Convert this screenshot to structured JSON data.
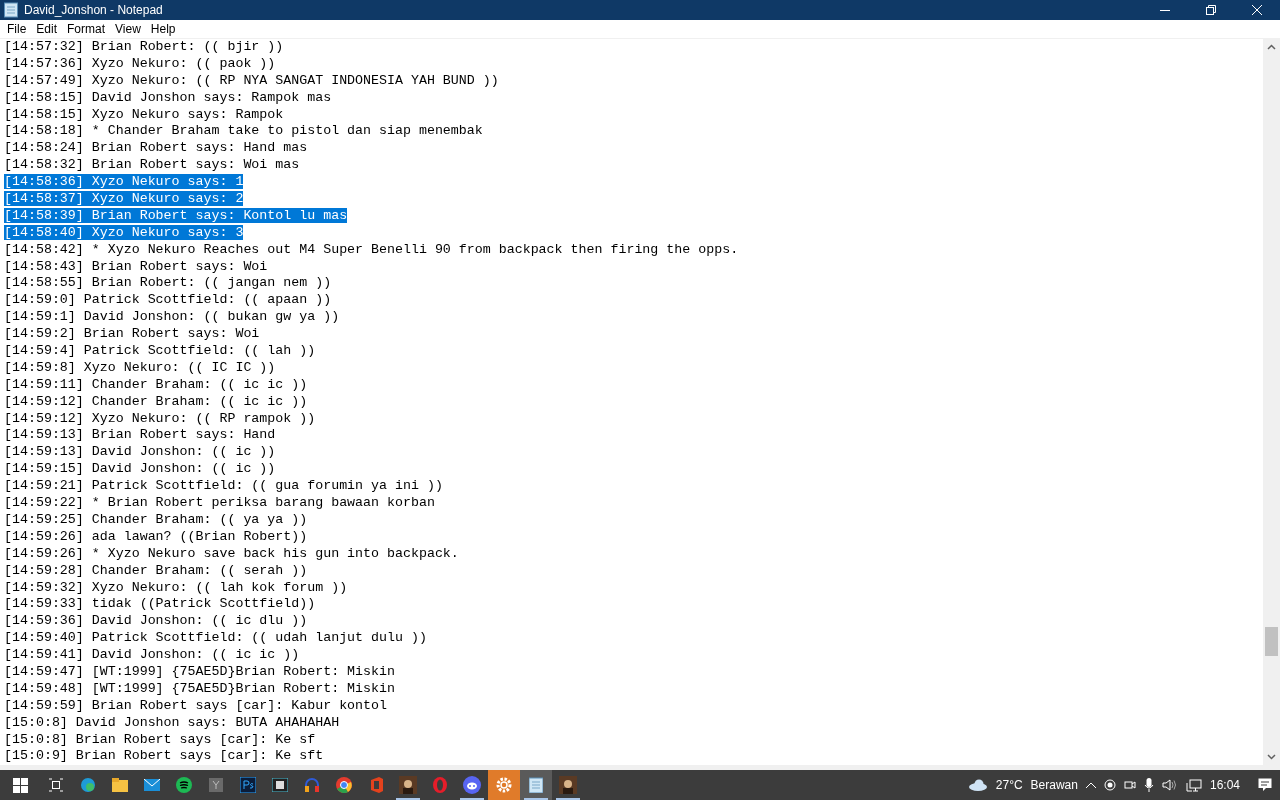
{
  "window": {
    "title": "David_Jonshon - Notepad"
  },
  "menu": [
    "File",
    "Edit",
    "Format",
    "View",
    "Help"
  ],
  "lines": [
    {
      "text": "[14:57:32] Brian Robert: (( bjir ))",
      "selected": false
    },
    {
      "text": "[14:57:36] Xyzo Nekuro: (( paok ))",
      "selected": false
    },
    {
      "text": "[14:57:49] Xyzo Nekuro: (( RP NYA SANGAT INDONESIA YAH BUND ))",
      "selected": false
    },
    {
      "text": "[14:58:15] David Jonshon says: Rampok mas",
      "selected": false
    },
    {
      "text": "[14:58:15] Xyzo Nekuro says: Rampok",
      "selected": false
    },
    {
      "text": "[14:58:18] * Chander Braham take to pistol dan siap menembak",
      "selected": false
    },
    {
      "text": "[14:58:24] Brian Robert says: Hand mas",
      "selected": false
    },
    {
      "text": "[14:58:32] Brian Robert says: Woi mas",
      "selected": false
    },
    {
      "text": "[14:58:36] Xyzo Nekuro says: 1",
      "selected": true
    },
    {
      "text": "[14:58:37] Xyzo Nekuro says: 2",
      "selected": true
    },
    {
      "text": "[14:58:39] Brian Robert says: Kontol lu mas",
      "selected": true
    },
    {
      "text": "[14:58:40] Xyzo Nekuro says: 3",
      "selected": true
    },
    {
      "text": "[14:58:42] * Xyzo Nekuro Reaches out M4 Super Benelli 90 from backpack then firing the opps.",
      "selected": false
    },
    {
      "text": "[14:58:43] Brian Robert says: Woi",
      "selected": false
    },
    {
      "text": "[14:58:55] Brian Robert: (( jangan nem ))",
      "selected": false
    },
    {
      "text": "[14:59:0] Patrick Scottfield: (( apaan ))",
      "selected": false
    },
    {
      "text": "[14:59:1] David Jonshon: (( bukan gw ya ))",
      "selected": false
    },
    {
      "text": "[14:59:2] Brian Robert says: Woi",
      "selected": false
    },
    {
      "text": "[14:59:4] Patrick Scottfield: (( lah ))",
      "selected": false
    },
    {
      "text": "[14:59:8] Xyzo Nekuro: (( IC IC ))",
      "selected": false
    },
    {
      "text": "[14:59:11] Chander Braham: (( ic ic ))",
      "selected": false
    },
    {
      "text": "[14:59:12] Chander Braham: (( ic ic ))",
      "selected": false
    },
    {
      "text": "[14:59:12] Xyzo Nekuro: (( RP rampok ))",
      "selected": false
    },
    {
      "text": "[14:59:13] Brian Robert says: Hand",
      "selected": false
    },
    {
      "text": "[14:59:13] David Jonshon: (( ic ))",
      "selected": false
    },
    {
      "text": "[14:59:15] David Jonshon: (( ic ))",
      "selected": false
    },
    {
      "text": "[14:59:21] Patrick Scottfield: (( gua forumin ya ini ))",
      "selected": false
    },
    {
      "text": "[14:59:22] * Brian Robert periksa barang bawaan korban",
      "selected": false
    },
    {
      "text": "[14:59:25] Chander Braham: (( ya ya ))",
      "selected": false
    },
    {
      "text": "[14:59:26] ada lawan? ((Brian Robert))",
      "selected": false
    },
    {
      "text": "[14:59:26] * Xyzo Nekuro save back his gun into backpack.",
      "selected": false
    },
    {
      "text": "[14:59:28] Chander Braham: (( serah ))",
      "selected": false
    },
    {
      "text": "[14:59:32] Xyzo Nekuro: (( lah kok forum ))",
      "selected": false
    },
    {
      "text": "[14:59:33] tidak ((Patrick Scottfield))",
      "selected": false
    },
    {
      "text": "[14:59:36] David Jonshon: (( ic dlu ))",
      "selected": false
    },
    {
      "text": "[14:59:40] Patrick Scottfield: (( udah lanjut dulu ))",
      "selected": false
    },
    {
      "text": "[14:59:41] David Jonshon: (( ic ic ))",
      "selected": false
    },
    {
      "text": "[14:59:47] [WT:1999] {75AE5D}Brian Robert: Miskin",
      "selected": false
    },
    {
      "text": "[14:59:48] [WT:1999] {75AE5D}Brian Robert: Miskin",
      "selected": false
    },
    {
      "text": "[14:59:59] Brian Robert says [car]: Kabur kontol",
      "selected": false
    },
    {
      "text": "[15:0:8] David Jonshon says: BUTA AHAHAHAH",
      "selected": false
    },
    {
      "text": "[15:0:8] Brian Robert says [car]: Ke sf",
      "selected": false
    },
    {
      "text": "[15:0:9] Brian Robert says [car]: Ke sft",
      "selected": false
    }
  ],
  "taskbar": {
    "apps": [
      {
        "kind": "edge",
        "running": false,
        "selected": false
      },
      {
        "kind": "folder",
        "running": false,
        "selected": false
      },
      {
        "kind": "mail",
        "running": false,
        "selected": false
      },
      {
        "kind": "music",
        "running": false,
        "selected": false
      },
      {
        "kind": "letter",
        "running": false,
        "selected": false
      },
      {
        "kind": "photo",
        "running": false,
        "selected": false
      },
      {
        "kind": "film",
        "running": false,
        "selected": false
      },
      {
        "kind": "headphones",
        "running": false,
        "selected": false
      },
      {
        "kind": "browser",
        "running": false,
        "selected": false
      },
      {
        "kind": "office",
        "running": false,
        "selected": false
      },
      {
        "kind": "game",
        "running": true,
        "selected": false
      },
      {
        "kind": "opera",
        "running": false,
        "selected": false
      },
      {
        "kind": "chat",
        "running": true,
        "selected": false
      },
      {
        "kind": "settings",
        "running": true,
        "selected": true
      },
      {
        "kind": "notepad",
        "running": true,
        "selected": false
      },
      {
        "kind": "game",
        "running": true,
        "selected": false
      }
    ],
    "weather": {
      "temperature": "27°C",
      "condition": "Berawan"
    },
    "clock": "16:04"
  }
}
